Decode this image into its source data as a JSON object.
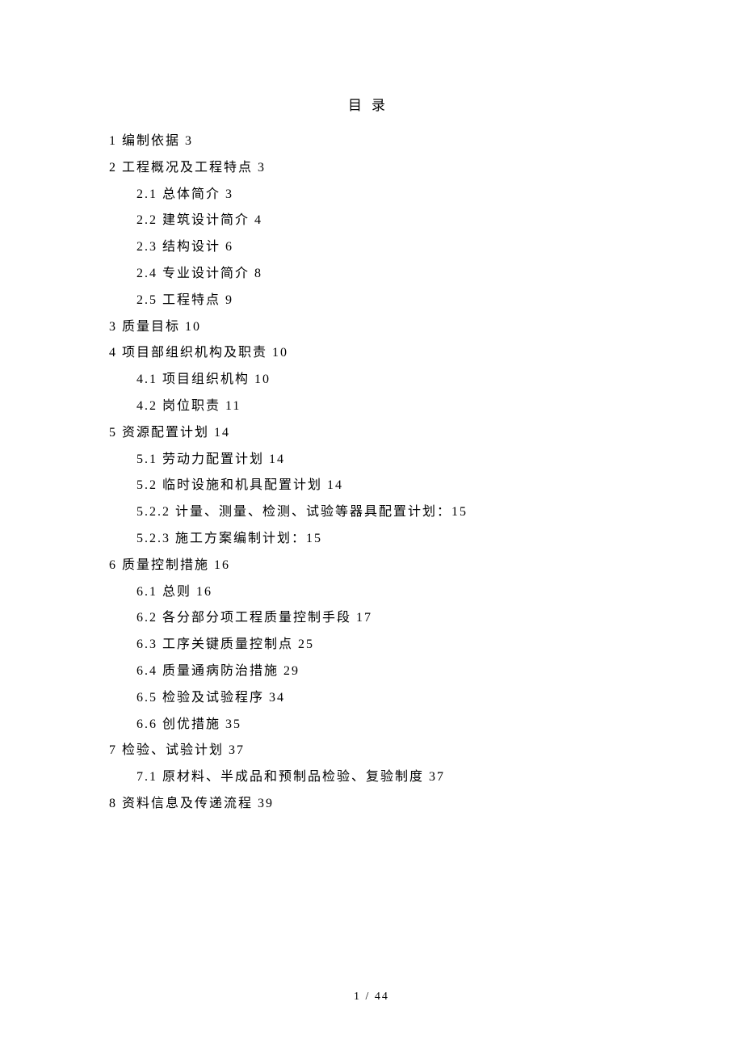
{
  "title": "目录",
  "toc": [
    {
      "level": 1,
      "text": "1 编制依据 3"
    },
    {
      "level": 1,
      "text": "2 工程概况及工程特点 3"
    },
    {
      "level": 2,
      "text": "2.1 总体简介 3"
    },
    {
      "level": 2,
      "text": "2.2 建筑设计简介 4"
    },
    {
      "level": 2,
      "text": "2.3 结构设计 6"
    },
    {
      "level": 2,
      "text": "2.4 专业设计简介 8"
    },
    {
      "level": 2,
      "text": "2.5 工程特点 9"
    },
    {
      "level": 1,
      "text": "3 质量目标 10"
    },
    {
      "level": 1,
      "text": "4 项目部组织机构及职责 10"
    },
    {
      "level": 2,
      "text": "4.1 项目组织机构 10"
    },
    {
      "level": 2,
      "text": "4.2 岗位职责 11"
    },
    {
      "level": 1,
      "text": "5 资源配置计划 14"
    },
    {
      "level": 2,
      "text": "5.1 劳动力配置计划 14"
    },
    {
      "level": 2,
      "text": "5.2 临时设施和机具配置计划 14"
    },
    {
      "level": 2,
      "text": "5.2.2 计量、测量、检测、试验等器具配置计划：15"
    },
    {
      "level": 2,
      "text": "5.2.3 施工方案编制计划：15"
    },
    {
      "level": 1,
      "text": "6 质量控制措施 16"
    },
    {
      "level": 2,
      "text": "6.1 总则 16"
    },
    {
      "level": 2,
      "text": "6.2 各分部分项工程质量控制手段 17"
    },
    {
      "level": 2,
      "text": "6.3 工序关键质量控制点 25"
    },
    {
      "level": 2,
      "text": "6.4 质量通病防治措施 29"
    },
    {
      "level": 2,
      "text": "6.5 检验及试验程序 34"
    },
    {
      "level": 2,
      "text": "6.6 创优措施 35"
    },
    {
      "level": 1,
      "text": "7 检验、试验计划 37"
    },
    {
      "level": 2,
      "text": "7.1 原材料、半成品和预制品检验、复验制度 37"
    },
    {
      "level": 1,
      "text": "8 资料信息及传递流程 39"
    }
  ],
  "footer": "1 / 44"
}
